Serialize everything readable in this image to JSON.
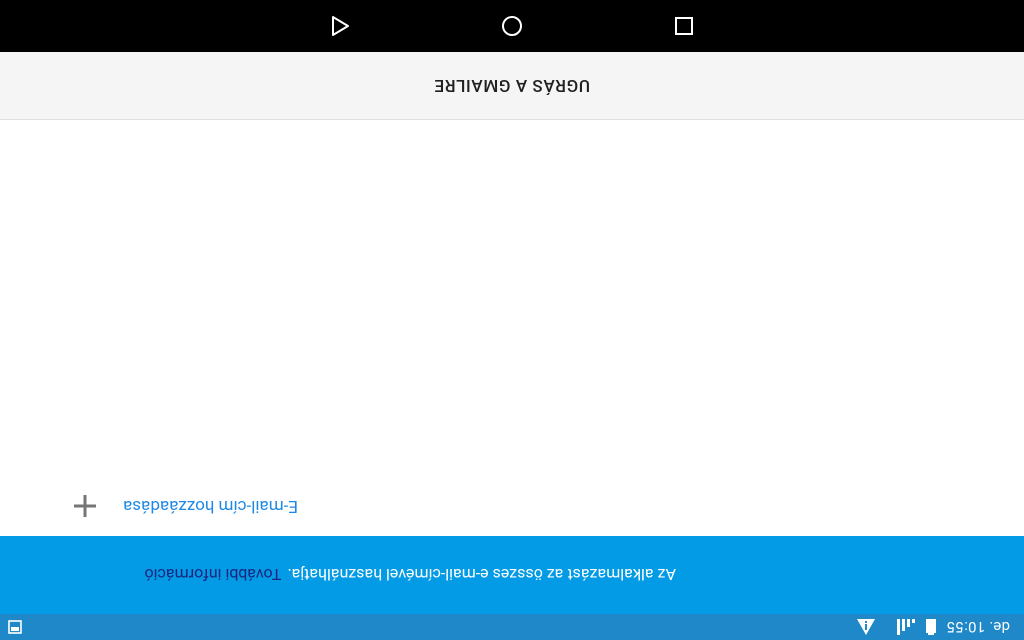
{
  "status_bar": {
    "clock": "de. 10:55",
    "icons": [
      "screenshot-icon",
      "battery-icon",
      "signal-icon",
      "warning-icon"
    ]
  },
  "info_banner": {
    "text": "Az alkalmazást az összes e-mail-címével használhatja.",
    "link": "További információ",
    "background": "#039be5"
  },
  "add_email": {
    "label": "E-mail-cím hozzáadása",
    "icon": "plus-icon",
    "color": "#1e88e5"
  },
  "gmail_bar": {
    "button_label": "UGRÁS A GMAILRE"
  },
  "nav_bar": {
    "buttons": [
      "back-icon",
      "home-icon",
      "recents-icon"
    ]
  }
}
